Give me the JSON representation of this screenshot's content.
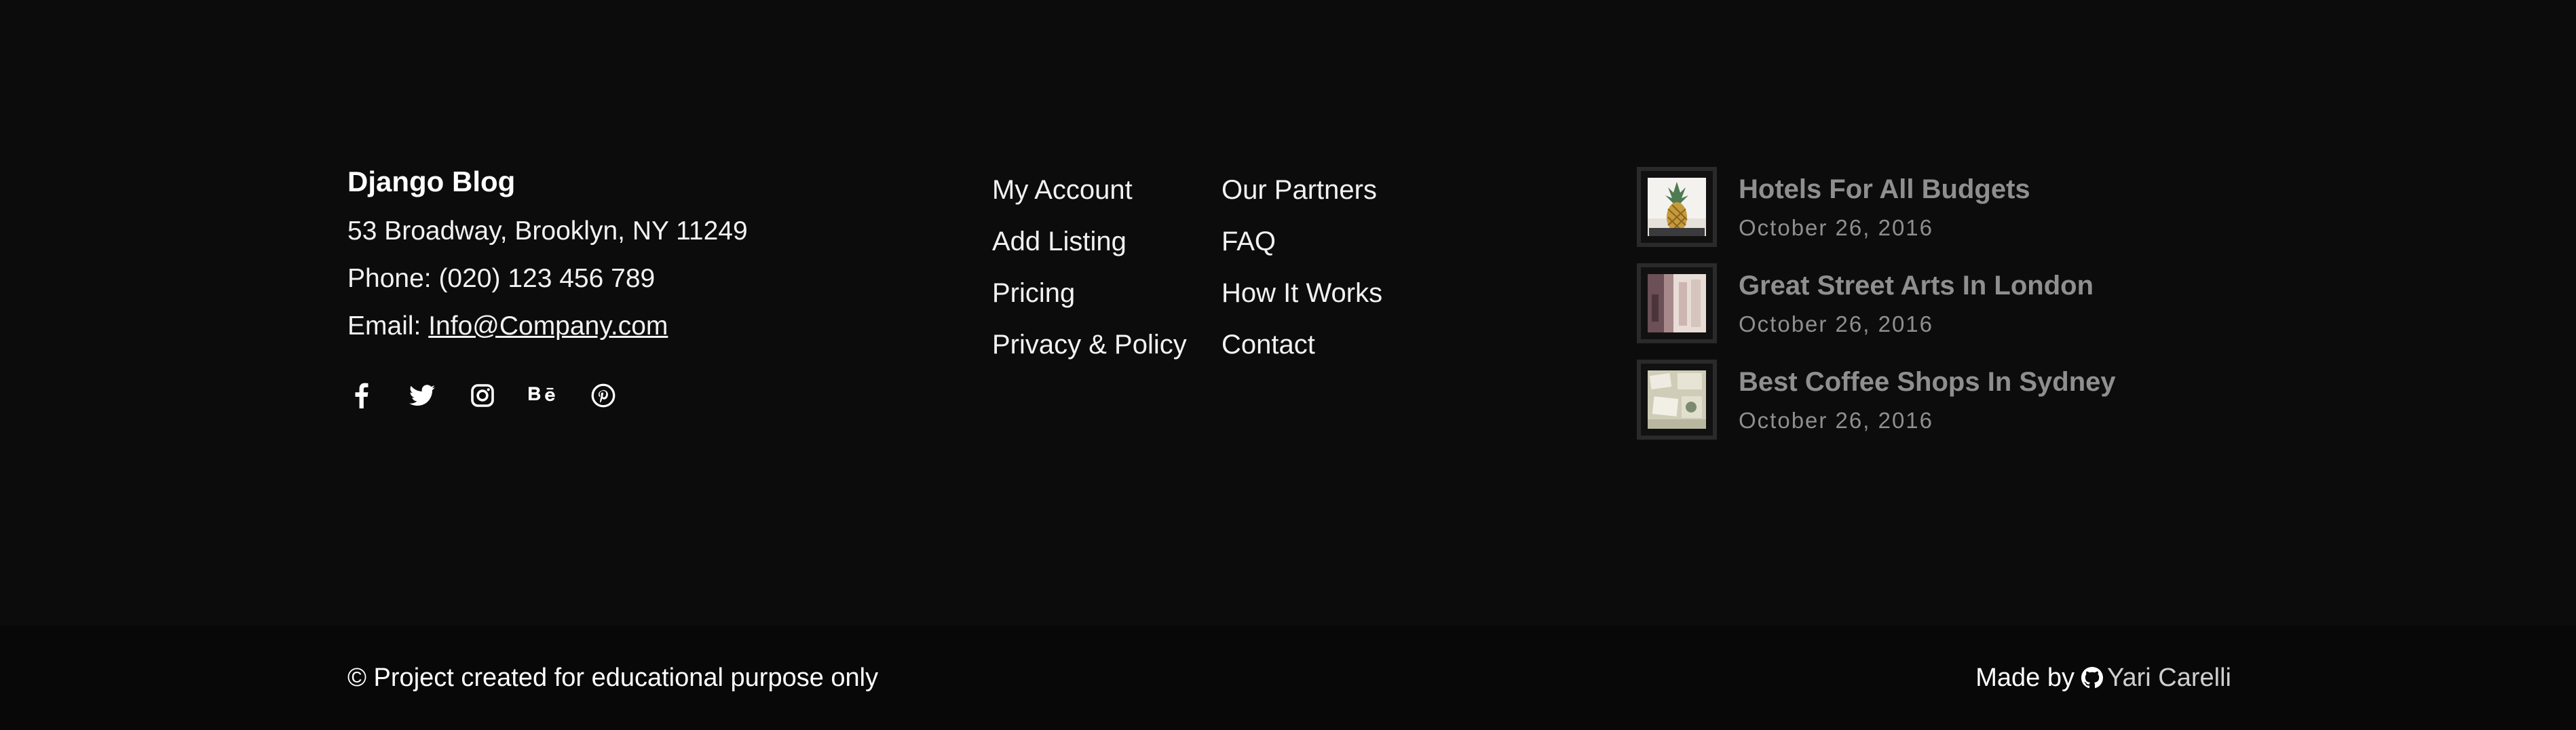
{
  "contact": {
    "brand": "Django Blog",
    "address": "53 Broadway, Brooklyn, NY 11249",
    "phone": "Phone: (020) 123 456 789",
    "email_label": "Email: ",
    "email": "Info@Company.com"
  },
  "social": [
    {
      "icon": "facebook-icon"
    },
    {
      "icon": "twitter-icon"
    },
    {
      "icon": "instagram-icon"
    },
    {
      "icon": "behance-icon"
    },
    {
      "icon": "pinterest-icon"
    }
  ],
  "links": {
    "col1": [
      "My Account",
      "Add Listing",
      "Pricing",
      "Privacy & Policy"
    ],
    "col2": [
      "Our Partners",
      "FAQ",
      "How It Works",
      "Contact"
    ]
  },
  "posts": [
    {
      "title": "Hotels For All Budgets",
      "date": "October 26, 2016",
      "thumb": "pineapple-photo"
    },
    {
      "title": "Great Street Arts In London",
      "date": "October 26, 2016",
      "thumb": "street-photo"
    },
    {
      "title": "Best Coffee Shops In Sydney",
      "date": "October 26, 2016",
      "thumb": "coffee-photo"
    }
  ],
  "bottom": {
    "copyright": "© Project created for educational purpose only",
    "made_by": "Made by",
    "github_icon": "github-icon",
    "author": "Yari Carelli"
  },
  "colors": {
    "background": "#0c0c0c",
    "bottom_bar": "#080808",
    "text": "#ffffff",
    "muted": "#8f8f8f"
  }
}
